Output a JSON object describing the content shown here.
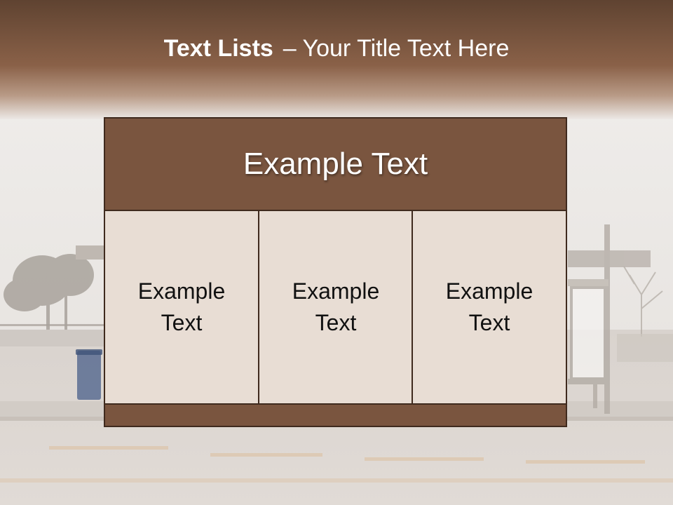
{
  "slide": {
    "title_bold": "Text Lists",
    "title_rest": "– Your Title Text Here"
  },
  "diagram": {
    "header": "Example Text",
    "cells": [
      {
        "line1": "Example",
        "line2": "Text"
      },
      {
        "line1": "Example",
        "line2": "Text"
      },
      {
        "line1": "Example",
        "line2": "Text"
      }
    ]
  },
  "colors": {
    "title_band": "#6a4a36",
    "box_fill": "#7a553f",
    "cell_fill": "#e8ddd4",
    "border": "#3f2a1e"
  },
  "background": {
    "scene": "bus-stop-street-photo"
  }
}
